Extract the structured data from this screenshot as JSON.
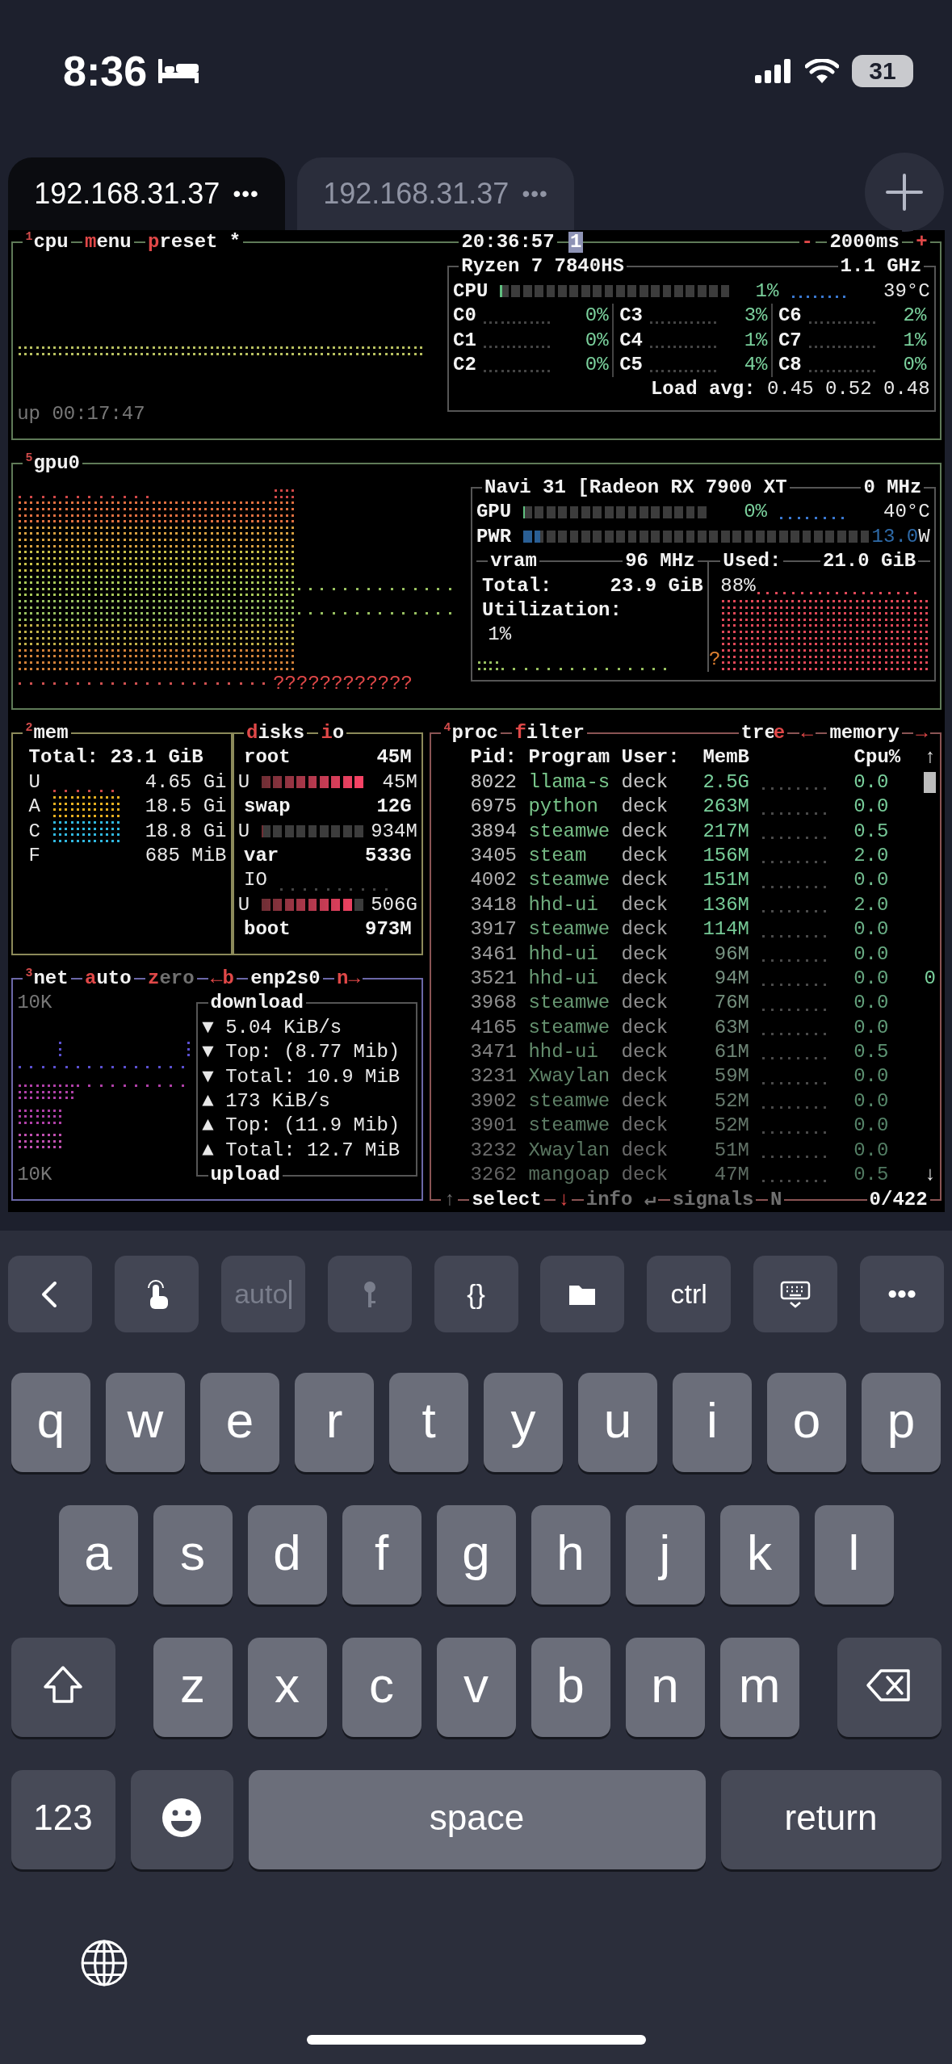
{
  "status_bar": {
    "time": "8:36",
    "battery": "31"
  },
  "tabs": [
    {
      "label": "192.168.31.37",
      "menu": "•••",
      "selected": true
    },
    {
      "label": "192.168.31.37",
      "menu": "•••",
      "selected": false
    }
  ],
  "terminal": {
    "cpu": {
      "header": {
        "left": [
          {
            "text": "$^{1}$cpu",
            "kind": "plain"
          },
          {
            "text": "menu",
            "kind": "lead_key"
          },
          {
            "text": "preset *",
            "kind": "lead_key"
          }
        ],
        "center": [
          {
            "text": "20:36:57",
            "kind": "plain"
          },
          {
            "text": "1",
            "kind": "badge"
          }
        ],
        "right": [
          {
            "text": "-",
            "kind": "key"
          },
          {
            "text": "2000ms",
            "kind": "plain"
          },
          {
            "text": "+",
            "kind": "key"
          }
        ]
      },
      "box": {
        "header": {
          "left": [
            {
              "text": "Ryzen 7 7840HS",
              "kind": "plain"
            }
          ],
          "right": [
            {
              "text": "1.1 GHz",
              "kind": "plain"
            }
          ]
        },
        "total": {
          "label": "CPU",
          "level": 0.01,
          "percent": "1%",
          "temp": "39°C"
        },
        "cores": [
          {
            "label": "C0",
            "percent": "0%"
          },
          {
            "label": "C1",
            "percent": "0%"
          },
          {
            "label": "C2",
            "percent": "0%"
          },
          {
            "label": "C3",
            "percent": "3%"
          },
          {
            "label": "C4",
            "percent": "1%"
          },
          {
            "label": "C5",
            "percent": "4%"
          },
          {
            "label": "C6",
            "percent": "2%"
          },
          {
            "label": "C7",
            "percent": "1%"
          },
          {
            "label": "C8",
            "percent": "0%"
          }
        ],
        "load_label": "Load avg:",
        "load": "0.45 0.52 0.48"
      },
      "uptime": "up 00:17:47"
    },
    "gpu": {
      "header": {
        "left": [
          {
            "text": "$^{5}$gpu0",
            "kind": "plain"
          }
        ]
      },
      "graph_mark": "????????????",
      "box": {
        "header": {
          "left": [
            {
              "text": "Navi 31 [Radeon RX 7900 XT",
              "kind": "plain"
            }
          ],
          "right": [
            {
              "text": "0 MHz",
              "kind": "plain"
            }
          ]
        },
        "meters": [
          {
            "kind": "load",
            "label": "GPU",
            "level": 0,
            "value": "0%",
            "temp": "40°C"
          },
          {
            "kind": "power",
            "label": "PWR",
            "level": 0.05,
            "value": "13.0",
            "unit": "W"
          }
        ],
        "vram": {
          "header": {
            "left": [
              {
                "text": "vram",
                "kind": "plain"
              }
            ],
            "right": [
              {
                "text": "96 MHz",
                "kind": "plain"
              }
            ]
          },
          "total_label": "Total:",
          "total": "23.9 GiB",
          "util_label": "Utilization:",
          "util": "1%"
        },
        "used": {
          "header": {
            "left": [
              {
                "text": "Used:",
                "kind": "plain"
              }
            ],
            "right": [
              {
                "text": "21.0 GiB",
                "kind": "plain"
              }
            ]
          },
          "percent": "88%",
          "mark": "?"
        }
      }
    },
    "mem": {
      "header": {
        "left": [
          {
            "text": "$^{2}$mem",
            "kind": "plain"
          }
        ]
      },
      "total": "Total: 23.1 GiB",
      "rows": [
        {
          "label": "U",
          "value": "4.65 Gi",
          "kind": "sparse",
          "color": "#c84848"
        },
        {
          "label": "A",
          "value": "18.5 Gi",
          "kind": "full",
          "color": "#e8b020"
        },
        {
          "label": "C",
          "value": "18.8 Gi",
          "kind": "full",
          "color": "#30b8e0"
        },
        {
          "label": "F",
          "value": "685 MiB",
          "kind": "none"
        }
      ]
    },
    "disks": {
      "header": {
        "left": [
          {
            "text": "disks",
            "kind": "lead_key"
          },
          {
            "text": "io",
            "kind": "lead_key"
          }
        ]
      },
      "items": [
        {
          "name": "root",
          "size": "45M",
          "used": {
            "label": "U",
            "level": 1,
            "value": "45M"
          }
        },
        {
          "name": "swap",
          "size": "12G",
          "used": {
            "label": "U",
            "level": 0,
            "value": "934M"
          }
        },
        {
          "name": "var",
          "size": "533G",
          "io": "IO",
          "used": {
            "label": "U",
            "level": 0.89,
            "value": "506G"
          }
        },
        {
          "name": "boot",
          "size": "973M"
        }
      ]
    },
    "net": {
      "header": {
        "left": [
          {
            "text": "$^{3}$net",
            "kind": "plain"
          },
          {
            "text": "auto",
            "kind": "lead_key"
          },
          {
            "text": "zero",
            "kind": "lead_key_dim"
          },
          {
            "text": "←b",
            "kind": "key"
          },
          {
            "text": "enp2s0",
            "kind": "plain"
          },
          {
            "text": "n→",
            "kind": "key"
          }
        ]
      },
      "scale_top": "10K",
      "scale_bottom": "10K",
      "box": {
        "header": {
          "left": [
            {
              "text": "download",
              "kind": "plain"
            }
          ]
        },
        "footer": {
          "left": [
            {
              "text": "upload",
              "kind": "plain"
            }
          ]
        },
        "rows": [
          {
            "arrow": "▼",
            "text": "5.04 KiB/s"
          },
          {
            "arrow": "▼",
            "text": "Top: (8.77 Mib)"
          },
          {
            "arrow": "▼",
            "text": "Total: 10.9 MiB"
          },
          {
            "arrow": "▲",
            "text": "173 KiB/s"
          },
          {
            "arrow": "▲",
            "text": "Top: (11.9 Mib)"
          },
          {
            "arrow": "▲",
            "text": "Total: 12.7 MiB"
          }
        ]
      }
    },
    "proc": {
      "header": {
        "left": [
          {
            "text": "$^{4}$proc",
            "kind": "plain"
          },
          {
            "text": "filter",
            "kind": "lead_key"
          }
        ],
        "right": [
          {
            "text": "tre",
            "kind": "plain"
          },
          {
            "text": "e",
            "kind": "suffix_key"
          },
          {
            "text": "←",
            "kind": "key"
          },
          {
            "text": "memory",
            "kind": "plain"
          },
          {
            "text": "→",
            "kind": "key"
          }
        ]
      },
      "columns": [
        "Pid:",
        "Program",
        "User:",
        "MemB",
        "Cpu%"
      ],
      "scroll": {
        "up": "↑",
        "down": "↓"
      },
      "rows": [
        {
          "pid": "8022",
          "program": "llama-s",
          "user": "deck",
          "mem": "2.5G",
          "cpu": "0.0"
        },
        {
          "pid": "6975",
          "program": "python",
          "user": "deck",
          "mem": "263M",
          "cpu": "0.0"
        },
        {
          "pid": "3894",
          "program": "steamwe",
          "user": "deck",
          "mem": "217M",
          "cpu": "0.5"
        },
        {
          "pid": "3405",
          "program": "steam",
          "user": "deck",
          "mem": "156M",
          "cpu": "2.0"
        },
        {
          "pid": "4002",
          "program": "steamwe",
          "user": "deck",
          "mem": "151M",
          "cpu": "0.0"
        },
        {
          "pid": "3418",
          "program": "hhd-ui",
          "user": "deck",
          "mem": "136M",
          "cpu": "2.0"
        },
        {
          "pid": "3917",
          "program": "steamwe",
          "user": "deck",
          "mem": "114M",
          "cpu": "0.0"
        },
        {
          "pid": "3461",
          "program": "hhd-ui",
          "user": "deck",
          "mem": "96M",
          "cpu": "0.0"
        },
        {
          "pid": "3521",
          "program": "hhd-ui",
          "user": "deck",
          "mem": "94M",
          "cpu": "0.0",
          "overflow": "0"
        },
        {
          "pid": "3968",
          "program": "steamwe",
          "user": "deck",
          "mem": "76M",
          "cpu": "0.0"
        },
        {
          "pid": "4165",
          "program": "steamwe",
          "user": "deck",
          "mem": "63M",
          "cpu": "0.0"
        },
        {
          "pid": "3471",
          "program": "hhd-ui",
          "user": "deck",
          "mem": "61M",
          "cpu": "0.5"
        },
        {
          "pid": "3231",
          "program": "Xwaylan",
          "user": "deck",
          "mem": "59M",
          "cpu": "0.0"
        },
        {
          "pid": "3902",
          "program": "steamwe",
          "user": "deck",
          "mem": "52M",
          "cpu": "0.0"
        },
        {
          "pid": "3901",
          "program": "steamwe",
          "user": "deck",
          "mem": "52M",
          "cpu": "0.0"
        },
        {
          "pid": "3232",
          "program": "Xwaylan",
          "user": "deck",
          "mem": "51M",
          "cpu": "0.0"
        },
        {
          "pid": "3262",
          "program": "mangoap",
          "user": "deck",
          "mem": "47M",
          "cpu": "0.5"
        }
      ],
      "footer": {
        "left": [
          {
            "text": "↑",
            "kind": "dim"
          },
          {
            "text": "select",
            "kind": "plain"
          },
          {
            "text": "↓",
            "kind": "key"
          },
          {
            "text": "info ↵",
            "kind": "dim"
          },
          {
            "text": "signals",
            "kind": "dim"
          },
          {
            "text": "N",
            "kind": "dim"
          }
        ],
        "right": [
          {
            "text": "0/422",
            "kind": "plain"
          }
        ]
      }
    }
  },
  "toolbar": [
    {
      "kind": "chevron",
      "disabled": false,
      "caret": false
    },
    {
      "kind": "hand",
      "disabled": false,
      "caret": false
    },
    {
      "kind": "text",
      "label": "auto",
      "disabled": true,
      "caret": true
    },
    {
      "kind": "key",
      "disabled": true,
      "caret": false
    },
    {
      "kind": "text",
      "label": "{}",
      "disabled": false,
      "caret": false
    },
    {
      "kind": "folder",
      "disabled": false,
      "caret": false
    },
    {
      "kind": "text",
      "label": "ctrl",
      "disabled": false,
      "caret": false
    },
    {
      "kind": "keyboard",
      "disabled": false,
      "caret": false
    },
    {
      "kind": "text",
      "label": "•••",
      "disabled": false,
      "caret": false
    }
  ],
  "keyboard": {
    "rows": [
      {
        "keys": [
          {
            "kind": "letter",
            "label": "q"
          },
          {
            "kind": "letter",
            "label": "w"
          },
          {
            "kind": "letter",
            "label": "e"
          },
          {
            "kind": "letter",
            "label": "r"
          },
          {
            "kind": "letter",
            "label": "t"
          },
          {
            "kind": "letter",
            "label": "y"
          },
          {
            "kind": "letter",
            "label": "u"
          },
          {
            "kind": "letter",
            "label": "i"
          },
          {
            "kind": "letter",
            "label": "o"
          },
          {
            "kind": "letter",
            "label": "p"
          }
        ]
      },
      {
        "keys": [
          {
            "kind": "letter",
            "label": "a"
          },
          {
            "kind": "letter",
            "label": "s"
          },
          {
            "kind": "letter",
            "label": "d"
          },
          {
            "kind": "letter",
            "label": "f"
          },
          {
            "kind": "letter",
            "label": "g"
          },
          {
            "kind": "letter",
            "label": "h"
          },
          {
            "kind": "letter",
            "label": "j"
          },
          {
            "kind": "letter",
            "label": "k"
          },
          {
            "kind": "letter",
            "label": "l"
          }
        ]
      },
      {
        "keys": [
          {
            "kind": "shift"
          },
          {
            "kind": "letter",
            "label": "z"
          },
          {
            "kind": "letter",
            "label": "x"
          },
          {
            "kind": "letter",
            "label": "c"
          },
          {
            "kind": "letter",
            "label": "v"
          },
          {
            "kind": "letter",
            "label": "b"
          },
          {
            "kind": "letter",
            "label": "n"
          },
          {
            "kind": "letter",
            "label": "m"
          },
          {
            "kind": "backspace"
          }
        ]
      },
      {
        "keys": [
          {
            "kind": "numbers",
            "label": "123"
          },
          {
            "kind": "emoji"
          },
          {
            "kind": "space",
            "label": "space"
          },
          {
            "kind": "return",
            "label": "return"
          }
        ]
      },
      {
        "keys": [
          {
            "kind": "globe"
          }
        ]
      }
    ]
  }
}
